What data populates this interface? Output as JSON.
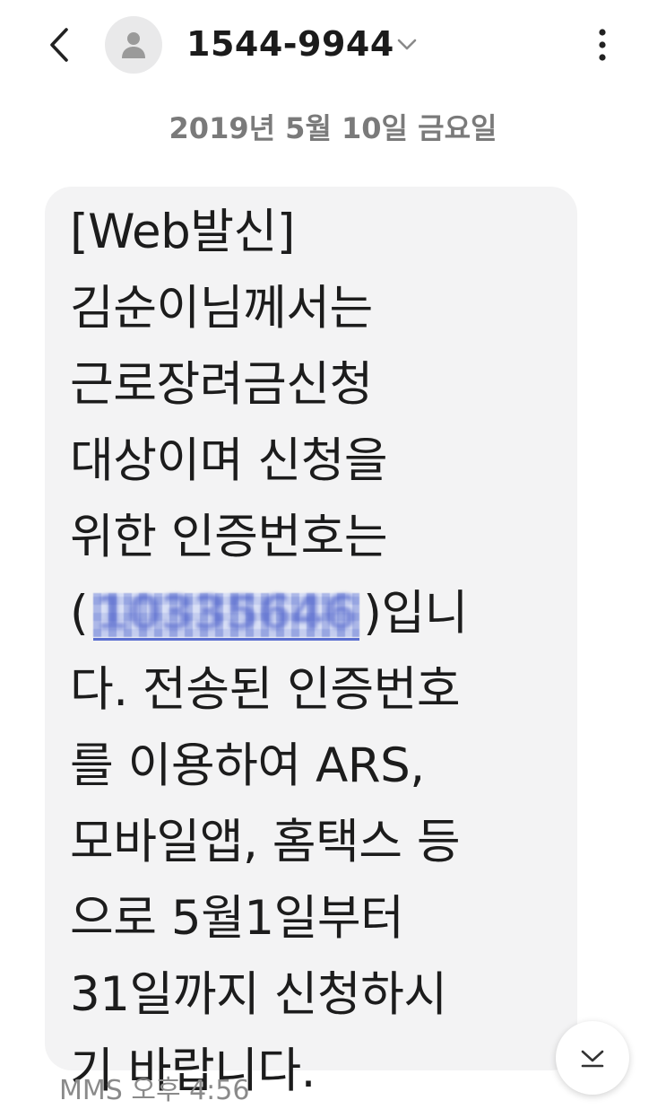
{
  "header": {
    "back_icon": "chevron-left-icon",
    "avatar_icon": "person-icon",
    "contact_name": "1544-9944",
    "expand_icon": "chevron-down-icon",
    "more_icon": "more-vertical-icon"
  },
  "conversation": {
    "date_label": "2019년 5월 10일 금요일",
    "message": {
      "lines": [
        "[Web발신]",
        "김순이님께서는",
        "근로장려금신청",
        "대상이며 신청을",
        "위한 인증번호는",
        "(",
        "입니",
        "다. 전송된 인증번호",
        "를 이용하여 ARS,",
        "모바일앱, 홈택스 등",
        "으로 5월1일부터",
        "31일까지 신청하시",
        "기 바랍니다."
      ],
      "code_close": ")",
      "code_value": "10335646",
      "type_label": "MMS",
      "time_label": "오후 4:56"
    }
  },
  "scroll_to_bottom_icon": "chevron-down-icon",
  "colors": {
    "bubble_bg": "#f3f3f4",
    "link": "#4a5ec6",
    "date_text": "#7a7a7a"
  }
}
